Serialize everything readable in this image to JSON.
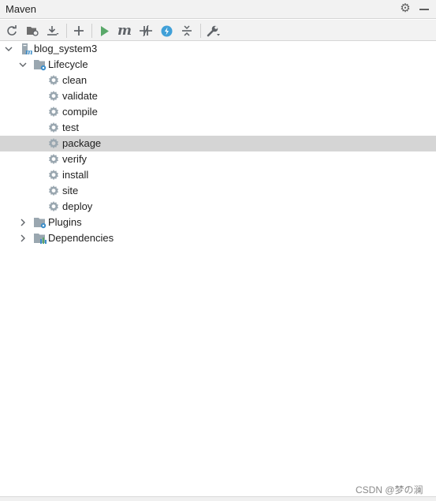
{
  "panel": {
    "title": "Maven"
  },
  "toolbar": {
    "buttons": [
      {
        "name": "reload-icon"
      },
      {
        "name": "generate-sources-icon"
      },
      {
        "name": "download-icon"
      },
      {
        "name": "add-icon"
      },
      {
        "name": "run-icon"
      },
      {
        "name": "execute-goal-icon",
        "glyph": "m"
      },
      {
        "name": "toggle-offline-icon"
      },
      {
        "name": "skip-tests-icon"
      },
      {
        "name": "collapse-all-icon"
      },
      {
        "name": "settings-wrench-icon"
      }
    ],
    "colors": {
      "run": "#59a869",
      "skip": "#40a0d8",
      "icon": "#5f6368"
    }
  },
  "tree": {
    "project": {
      "label": "blog_system3",
      "expanded": true
    },
    "lifecycle": {
      "label": "Lifecycle",
      "expanded": true,
      "goals": [
        "clean",
        "validate",
        "compile",
        "test",
        "package",
        "verify",
        "install",
        "site",
        "deploy"
      ],
      "selected": "package"
    },
    "plugins": {
      "label": "Plugins",
      "expanded": false
    },
    "dependencies": {
      "label": "Dependencies",
      "expanded": false
    }
  },
  "watermark": "CSDN @梦の澜"
}
